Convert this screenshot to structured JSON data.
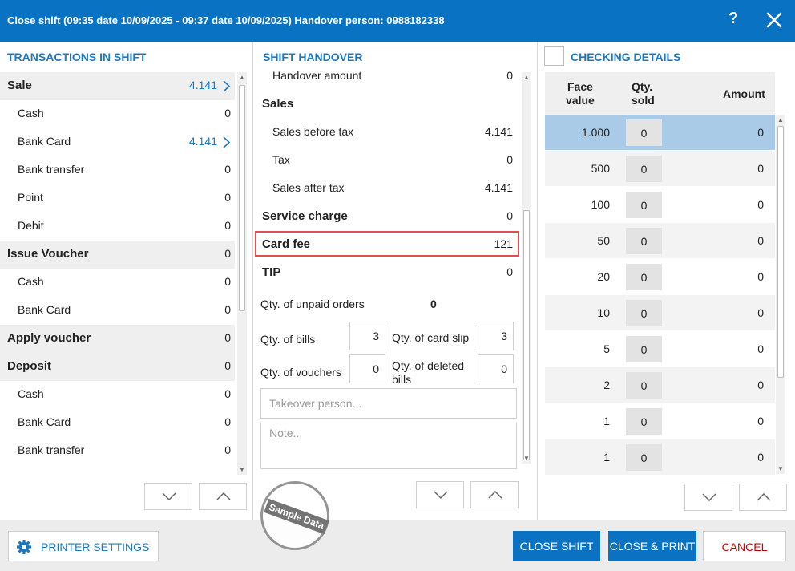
{
  "window": {
    "title": "Close shift (09:35 date 10/09/2025 - 09:37 date 10/09/2025) Handover person: 0988182338",
    "help_label": "?"
  },
  "left": {
    "heading": "TRANSACTIONS IN SHIFT",
    "rows": [
      {
        "label": "Sale",
        "value": "4.141",
        "type": "cat",
        "link": true
      },
      {
        "label": "Cash",
        "value": "0",
        "type": "sub"
      },
      {
        "label": "Bank Card",
        "value": "4.141",
        "type": "sub",
        "link": true
      },
      {
        "label": "Bank transfer",
        "value": "0",
        "type": "sub"
      },
      {
        "label": "Point",
        "value": "0",
        "type": "sub"
      },
      {
        "label": "Debit",
        "value": "0",
        "type": "sub"
      },
      {
        "label": "Issue Voucher",
        "value": "0",
        "type": "cat"
      },
      {
        "label": "Cash",
        "value": "0",
        "type": "sub"
      },
      {
        "label": "Bank Card",
        "value": "0",
        "type": "sub"
      },
      {
        "label": "Apply voucher",
        "value": "0",
        "type": "cat"
      },
      {
        "label": "Deposit",
        "value": "0",
        "type": "cat"
      },
      {
        "label": "Cash",
        "value": "0",
        "type": "sub"
      },
      {
        "label": "Bank Card",
        "value": "0",
        "type": "sub"
      },
      {
        "label": "Bank transfer",
        "value": "0",
        "type": "sub"
      }
    ]
  },
  "middle": {
    "heading": "SHIFT HANDOVER",
    "handover_amount": {
      "label": "Handover amount",
      "value": "0"
    },
    "sales_label": "Sales",
    "sales_before_tax": {
      "label": "Sales before tax",
      "value": "4.141"
    },
    "tax": {
      "label": "Tax",
      "value": "0"
    },
    "sales_after_tax": {
      "label": "Sales after tax",
      "value": "4.141"
    },
    "service_charge": {
      "label": "Service charge",
      "value": "0"
    },
    "card_fee": {
      "label": "Card fee",
      "value": "121"
    },
    "tip": {
      "label": "TIP",
      "value": "0"
    },
    "unpaid_orders": {
      "label": "Qty. of unpaid orders",
      "value": "0"
    },
    "bills": {
      "label": "Qty. of bills",
      "value": "3"
    },
    "card_slip": {
      "label": "Qty. of card slip",
      "value": "3"
    },
    "vouchers": {
      "label": "Qty. of vouchers",
      "value": "0"
    },
    "deleted_bills": {
      "label_line1": "Qty. of deleted",
      "label_line2": "bills",
      "value": "0"
    },
    "takeover_placeholder": "Takeover person...",
    "note_placeholder": "Note..."
  },
  "right": {
    "heading": "CHECKING DETAILS",
    "col_face_line1": "Face",
    "col_face_line2": "value",
    "col_qty_line1": "Qty.",
    "col_qty_line2": "sold",
    "col_amount": "Amount",
    "rows": [
      {
        "face": "1.000",
        "qty": "0",
        "amount": "0"
      },
      {
        "face": "500",
        "qty": "0",
        "amount": "0"
      },
      {
        "face": "100",
        "qty": "0",
        "amount": "0"
      },
      {
        "face": "50",
        "qty": "0",
        "amount": "0"
      },
      {
        "face": "20",
        "qty": "0",
        "amount": "0"
      },
      {
        "face": "10",
        "qty": "0",
        "amount": "0"
      },
      {
        "face": "5",
        "qty": "0",
        "amount": "0"
      },
      {
        "face": "2",
        "qty": "0",
        "amount": "0"
      },
      {
        "face": "1",
        "qty": "0",
        "amount": "0"
      },
      {
        "face": "1",
        "qty": "0",
        "amount": "0"
      }
    ]
  },
  "footer": {
    "printer_settings": "PRINTER SETTINGS",
    "close_shift": "CLOSE SHIFT",
    "close_print": "CLOSE & PRINT",
    "cancel": "CANCEL"
  },
  "watermark": "Sample Data",
  "colors": {
    "accent": "#0a72c2",
    "highlight_border": "#e04f4f",
    "cancel_text": "#cc0000"
  }
}
